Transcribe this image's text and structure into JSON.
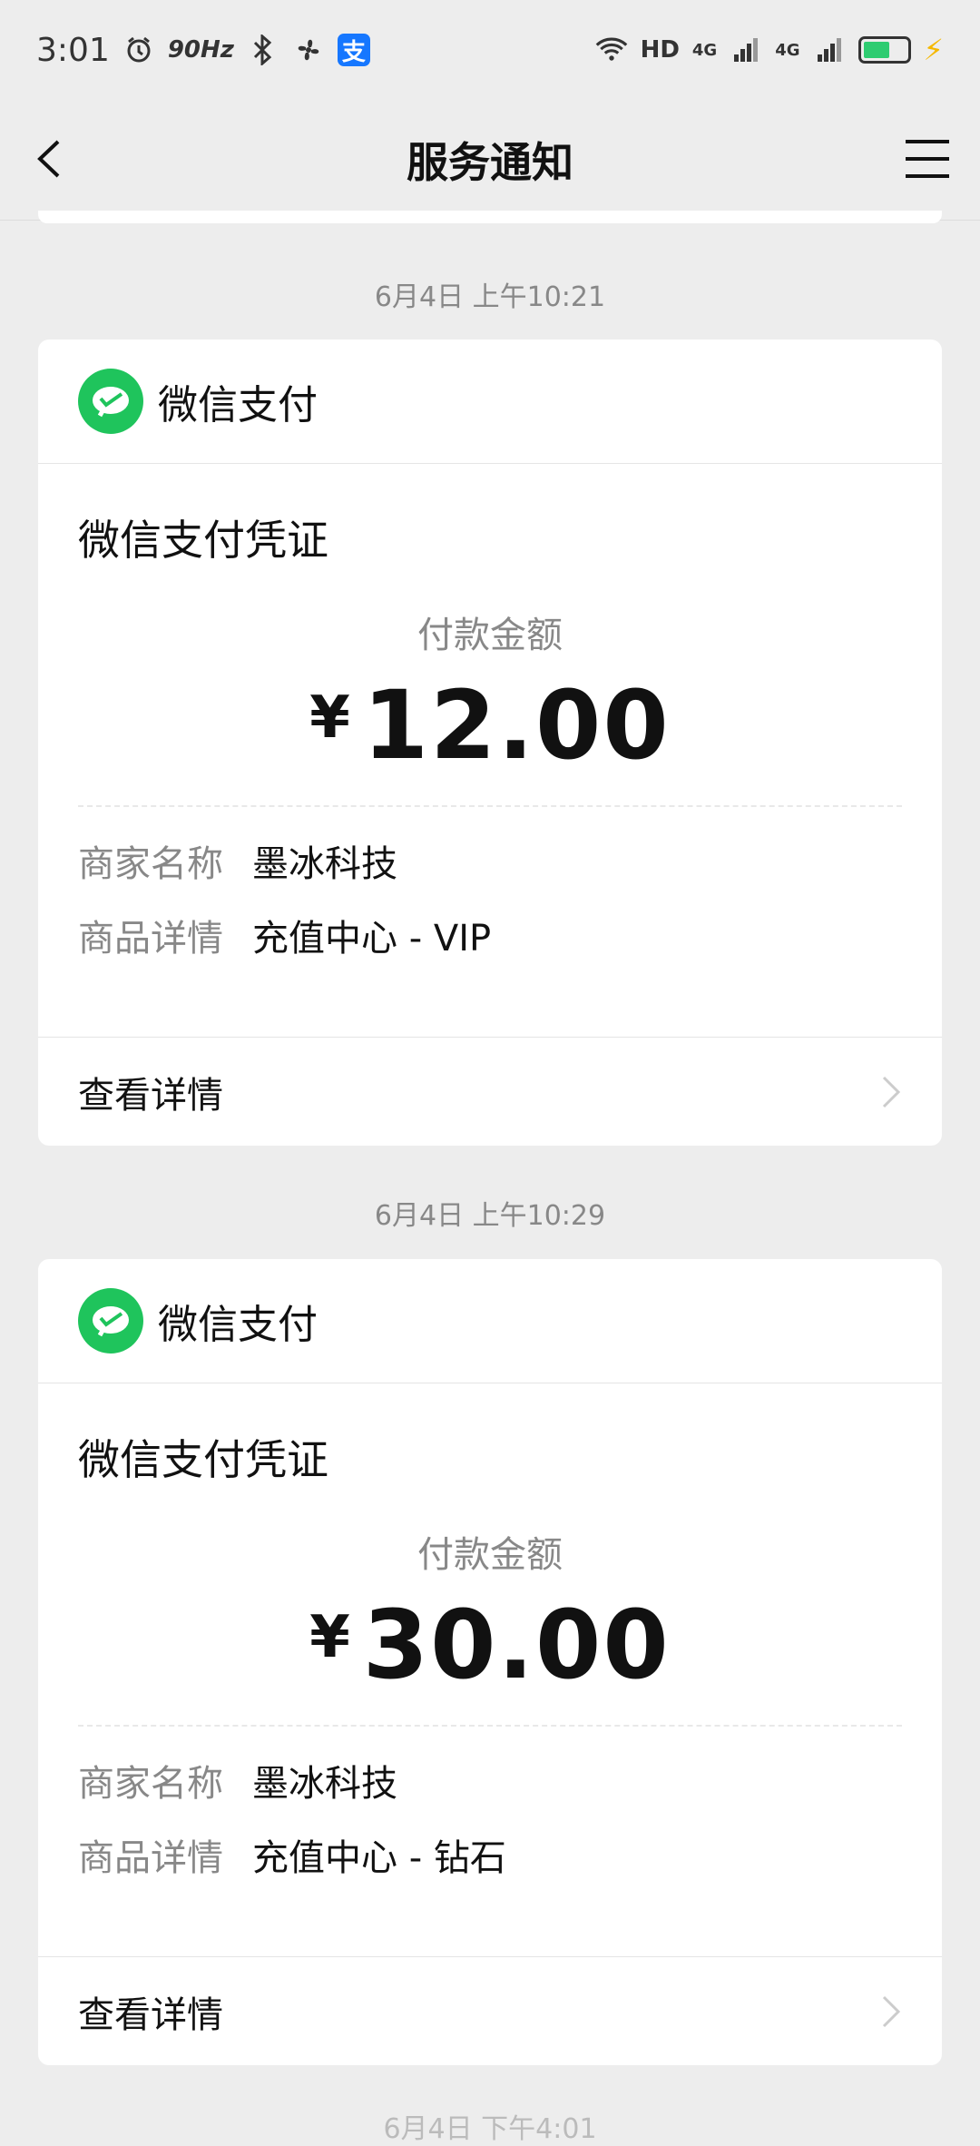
{
  "status_bar": {
    "time": "3:01",
    "refresh": "90Hz",
    "network": "HD",
    "sim1": "4G",
    "sim2": "4G",
    "alipay_glyph": "支",
    "battery_color": "#2ecc71",
    "battery_level": 0.62
  },
  "header": {
    "title": "服务通知"
  },
  "notifications": [
    {
      "timestamp": "6月4日 上午10:21",
      "app_name": "微信支付",
      "voucher_title": "微信支付凭证",
      "amount_label": "付款金额",
      "currency": "¥",
      "amount": "12.00",
      "merchant_label": "商家名称",
      "merchant": "墨冰科技",
      "product_label": "商品详情",
      "product": "充值中心 - VIP",
      "detail_link": "查看详情"
    },
    {
      "timestamp": "6月4日 上午10:29",
      "app_name": "微信支付",
      "voucher_title": "微信支付凭证",
      "amount_label": "付款金额",
      "currency": "¥",
      "amount": "30.00",
      "merchant_label": "商家名称",
      "merchant": "墨冰科技",
      "product_label": "商品详情",
      "product": "充值中心 - 钻石",
      "detail_link": "查看详情"
    }
  ],
  "next_timestamp_partial": "6月4日 下午4:01",
  "colors": {
    "background": "#ededed",
    "wechat_green": "#1fc45c",
    "muted_text": "#888888"
  }
}
